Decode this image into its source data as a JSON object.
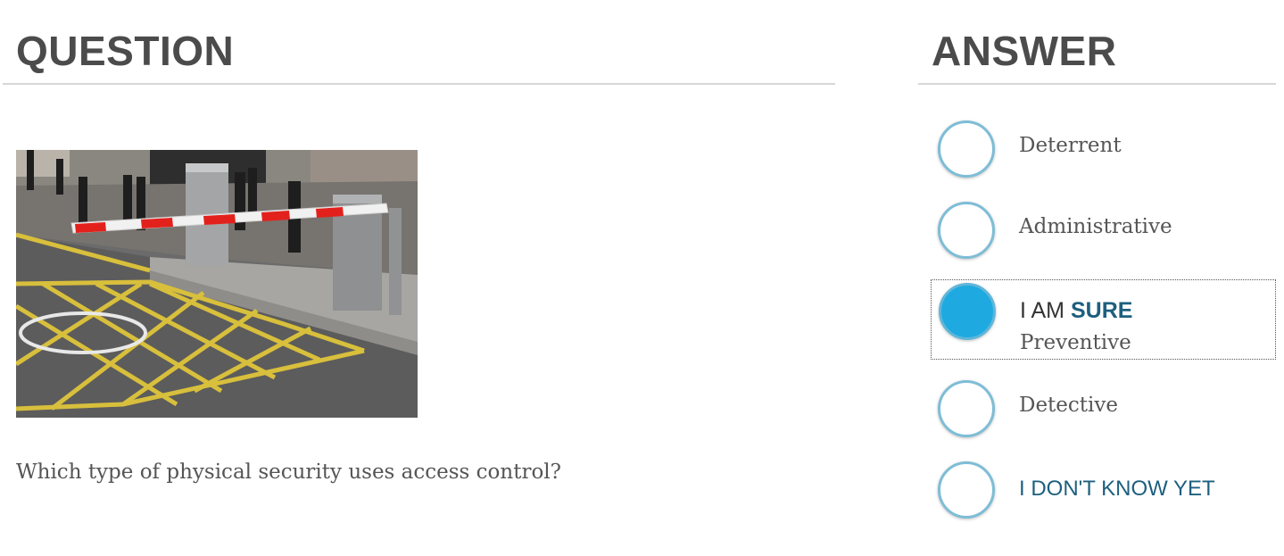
{
  "question_panel": {
    "heading": "QUESTION",
    "image_alt": "parking barrier gate",
    "text": "Which type of physical security uses access control?"
  },
  "answer_panel": {
    "heading": "ANSWER",
    "options": [
      {
        "label": "Deterrent",
        "selected": false
      },
      {
        "label": "Administrative",
        "selected": false
      },
      {
        "label": "Preventive",
        "selected": true,
        "confidence_prefix": "I AM",
        "confidence_strong": "SURE"
      },
      {
        "label": "Detective",
        "selected": false
      },
      {
        "label": "I DON'T KNOW YET",
        "selected": false
      }
    ]
  },
  "colors": {
    "heading": "#4b4b4b",
    "radio_border": "#7ebdd6",
    "radio_selected_fill": "#1ea9e1",
    "accent_text": "#1d5f7f"
  }
}
